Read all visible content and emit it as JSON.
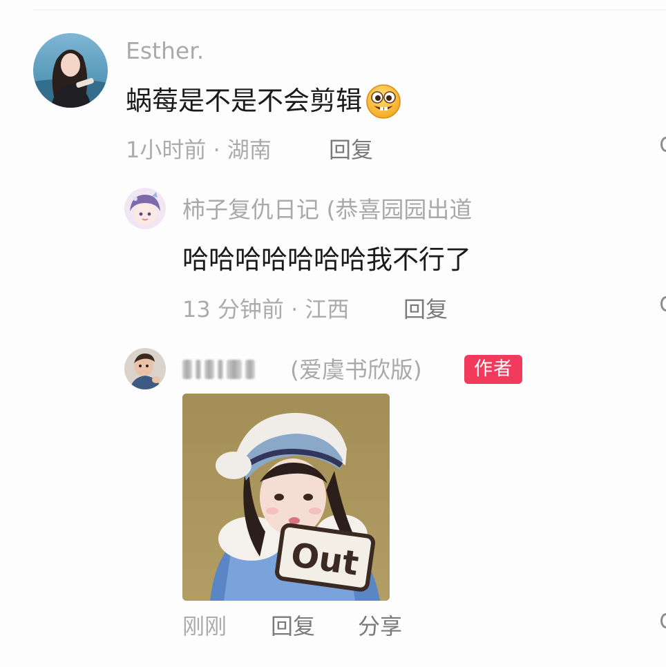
{
  "comments": [
    {
      "username": "Esther.",
      "text": "蜗莓是不是不会剪辑",
      "emoji": "grinning-face-emoji",
      "meta": "1小时前 · 湖南",
      "reply_label": "回复"
    },
    {
      "username": "柿子复仇日记 (恭喜园园出道",
      "text": "哈哈哈哈哈哈哈我不行了",
      "meta": "13 分钟前 · 江西",
      "reply_label": "回复"
    },
    {
      "username_suffix": "(爱虞书欣版)",
      "author_badge": "作者",
      "image_text": "Out",
      "meta": "刚刚",
      "reply_label": "回复",
      "share_label": "分享"
    }
  ],
  "colors": {
    "author_badge": "#f23a5d",
    "username": "#a9a9a9",
    "meta": "#ababab",
    "action": "#7a7a7a",
    "text": "#1a1a1a"
  },
  "icons": [
    "grinning-face-emoji",
    "more-options-icon"
  ]
}
